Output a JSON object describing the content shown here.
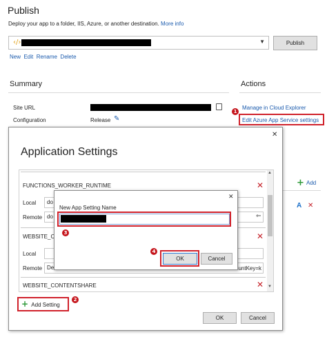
{
  "publish": {
    "title": "Publish",
    "description": "Deploy your app to a folder, IIS, Azure, or another destination.",
    "more_info": "More info",
    "publish_button": "Publish",
    "profile_actions": [
      "New",
      "Edit",
      "Rename",
      "Delete"
    ]
  },
  "summary": {
    "heading": "Summary",
    "site_url_label": "Site URL",
    "configuration_label": "Configuration",
    "configuration_value": "Release"
  },
  "actions": {
    "heading": "Actions",
    "manage_cloud_explorer": "Manage in Cloud Explorer",
    "edit_azure_settings": "Edit Azure App Service settings"
  },
  "side_panel": {
    "add_label": "Add"
  },
  "app_settings": {
    "title": "Application Settings",
    "local_label": "Local",
    "remote_label": "Remote",
    "sections": [
      {
        "name": "FUNCTIONS_WORKER_RUNTIME",
        "local": "do",
        "remote": "do"
      },
      {
        "name": "WEBSITE_CON",
        "local": "",
        "remote": "De",
        "remote_tail": "ountKey=k"
      },
      {
        "name": "WEBSITE_CONTENTSHARE"
      }
    ],
    "add_setting": "Add Setting",
    "ok": "OK",
    "cancel": "Cancel"
  },
  "new_setting_dialog": {
    "label": "New App Setting Name",
    "ok": "OK",
    "cancel": "Cancel"
  },
  "callouts": [
    "1",
    "2",
    "3",
    "4"
  ],
  "colors": {
    "accent_link": "#1a5aad",
    "callout_red": "#c5151c",
    "delete_red": "#c5222a",
    "add_green": "#2f9a3a"
  }
}
